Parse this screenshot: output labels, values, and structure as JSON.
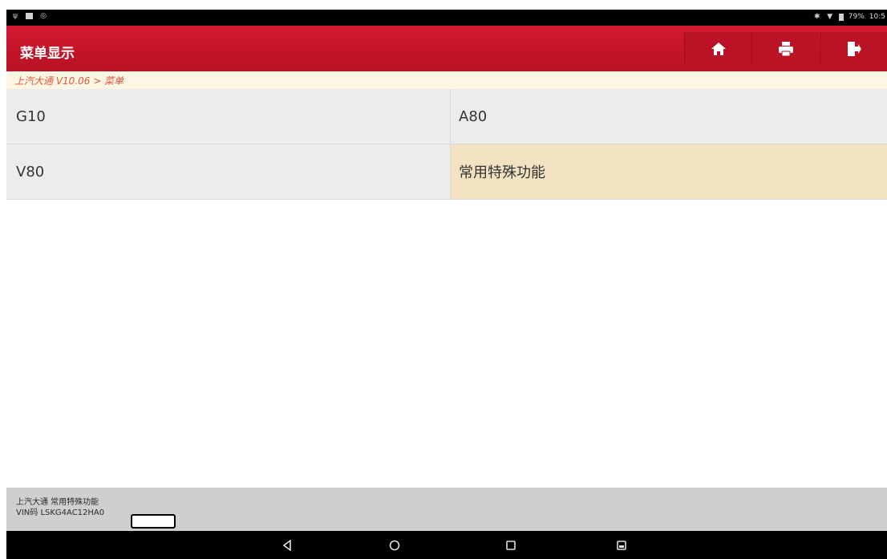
{
  "status_bar": {
    "battery": "79%",
    "time": "10:5"
  },
  "header": {
    "title": "菜单显示",
    "buttons": [
      {
        "icon": "home-icon"
      },
      {
        "icon": "print-icon"
      },
      {
        "icon": "exit-icon"
      }
    ]
  },
  "breadcrumb": "上汽大通 V10.06 > 菜单",
  "menu": {
    "items": [
      {
        "label": "G10"
      },
      {
        "label": "A80"
      },
      {
        "label": "V80"
      },
      {
        "label": "常用特殊功能",
        "selected": true
      }
    ]
  },
  "footer": {
    "line1": "上汽大通 常用特殊功能",
    "line2": "VIN码 LSKG4AC12HA0"
  },
  "nav": {
    "buttons": [
      {
        "icon": "back-icon"
      },
      {
        "icon": "home-circle-icon"
      },
      {
        "icon": "recents-icon"
      },
      {
        "icon": "screenshot-icon"
      }
    ]
  },
  "colors": {
    "header_red": "#c8162a",
    "breadcrumb_text": "#e5543e",
    "selected_item": "#f3e2c2"
  }
}
